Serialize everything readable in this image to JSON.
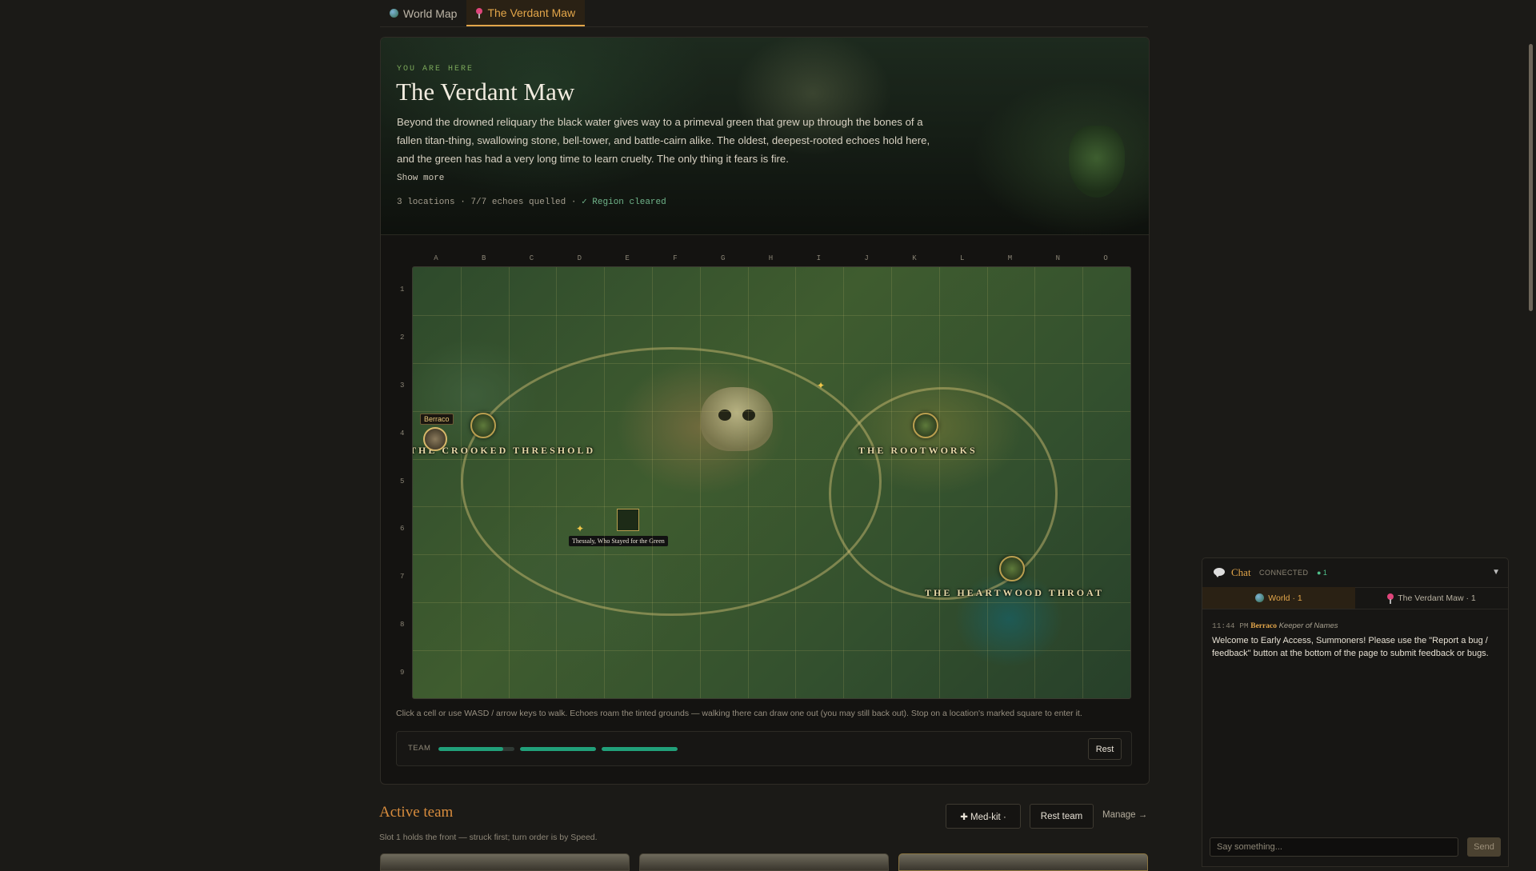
{
  "tabs": [
    {
      "label": "World Map",
      "icon": "globe-icon",
      "active": false
    },
    {
      "label": "The Verdant Maw",
      "icon": "pin-icon",
      "active": true
    }
  ],
  "hero": {
    "eyebrow": "YOU ARE HERE",
    "title": "The Verdant Maw",
    "description": "Beyond the drowned reliquary the black water gives way to a primeval green that grew up through the bones of a fallen titan-thing, swallowing stone, bell-tower, and battle-cairn alike. The oldest, deepest-rooted echoes hold here, and the green has had a very long time to learn cruelty. The only thing it fears is fire.",
    "show_more": "Show more",
    "meta_locations": "3 locations",
    "meta_echoes": "7/7 echoes quelled",
    "meta_status": "✓ Region cleared"
  },
  "map": {
    "columns": [
      "A",
      "B",
      "C",
      "D",
      "E",
      "F",
      "G",
      "H",
      "I",
      "J",
      "K",
      "L",
      "M",
      "N",
      "O"
    ],
    "rows": [
      "1",
      "2",
      "3",
      "4",
      "5",
      "6",
      "7",
      "8",
      "9"
    ],
    "locations": [
      {
        "label": "THE CROOKED THRESHOLD"
      },
      {
        "label": "THE ROOTWORKS"
      },
      {
        "label": "THE HEARTWOOD THROAT"
      }
    ],
    "player_name": "Berraco",
    "npc_name": "Thessaly, Who Stayed for the Green"
  },
  "help_text": "Click a cell or use WASD / arrow keys to walk. Echoes roam the tinted grounds — walking there can draw one out (you may still back out). Stop on a location's marked square to enter it.",
  "team_bar": {
    "label": "TEAM",
    "health": [
      0.85,
      1.0,
      1.0
    ],
    "rest_label": "Rest"
  },
  "active_team": {
    "title": "Active team",
    "subtitle": "Slot 1 holds the front — struck first; turn order is by Speed.",
    "medkit_label": "✚ Med-kit ·",
    "rest_team_label": "Rest team",
    "manage_label": "Manage →"
  },
  "chat": {
    "title": "Chat",
    "status": "CONNECTED",
    "online": "● 1",
    "collapse": "▼",
    "tabs": [
      {
        "label": "World · 1",
        "active": true
      },
      {
        "label": "The Verdant Maw · 1",
        "active": false
      }
    ],
    "messages": [
      {
        "time": "11:44 PM",
        "user": "Berraco",
        "role": "Keeper of Names",
        "text": "Welcome to Early Access, Summoners! Please use the \"Report a bug / feedback\" button at the bottom of the page to submit feedback or bugs."
      }
    ],
    "input_placeholder": "Say something...",
    "send_label": "Send"
  },
  "colors": {
    "accent": "#e3a64a",
    "success": "#21a07a",
    "background": "#1b1a17"
  }
}
